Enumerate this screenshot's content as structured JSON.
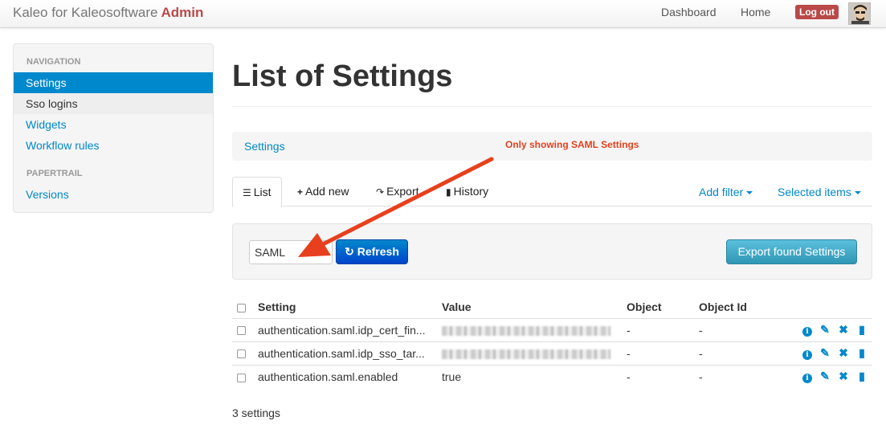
{
  "navbar": {
    "brand": "Kaleo for Kaleosoftware",
    "brand_admin": "Admin",
    "links": [
      "Dashboard",
      "Home"
    ],
    "logout": "Log out",
    "avatar_icon": "user-avatar"
  },
  "sidebar": {
    "sections": [
      {
        "header": "NAVIGATION",
        "items": [
          "Settings",
          "Sso logins",
          "Widgets",
          "Workflow rules"
        ]
      },
      {
        "header": "PAPERTRAIL",
        "items": [
          "Versions"
        ]
      }
    ]
  },
  "main": {
    "title": "List of Settings",
    "breadcrumb": "Settings",
    "annotation": "Only showing SAML Settings",
    "tabs": [
      {
        "icon": "list-icon",
        "label": "List"
      },
      {
        "icon": "plus-icon",
        "label": "Add new"
      },
      {
        "icon": "share-icon",
        "label": "Export"
      },
      {
        "icon": "book-icon",
        "label": "History"
      }
    ],
    "add_filter": "Add filter",
    "selected_items": "Selected items",
    "search_value": "SAML",
    "refresh_label": "Refresh",
    "export_label": "Export found Settings",
    "table": {
      "headers": [
        "Setting",
        "Value",
        "Object",
        "Object Id"
      ],
      "rows": [
        {
          "setting": "authentication.saml.idp_cert_fin...",
          "value": "",
          "object": "-",
          "object_id": "-"
        },
        {
          "setting": "authentication.saml.idp_sso_tar...",
          "value": "",
          "object": "-",
          "object_id": "-"
        },
        {
          "setting": "authentication.saml.enabled",
          "value": "true",
          "object": "-",
          "object_id": "-"
        }
      ],
      "row_actions": [
        "info-icon",
        "pencil-icon",
        "remove-icon",
        "book-icon"
      ]
    },
    "count": "3 settings"
  }
}
